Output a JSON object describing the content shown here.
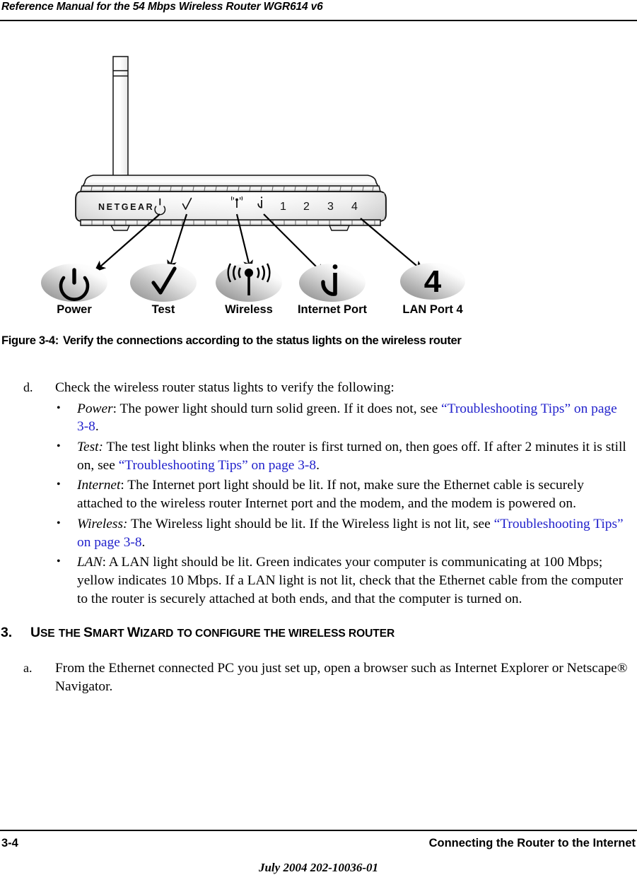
{
  "header": {
    "title": "Reference Manual for the 54 Mbps Wireless Router WGR614 v6"
  },
  "figure": {
    "router": {
      "brand": "NETGEAR",
      "led_labels": [
        "1",
        "2",
        "3",
        "4"
      ],
      "icons": [
        "power-icon",
        "test-check-icon",
        "wireless-icon",
        "internet-port-icon"
      ]
    },
    "callouts": [
      {
        "icon": "power-icon",
        "label": "Power"
      },
      {
        "icon": "test-check-icon",
        "label": "Test"
      },
      {
        "icon": "wireless-icon",
        "label": "Wireless"
      },
      {
        "icon": "internet-port-icon",
        "label": "Internet Port"
      },
      {
        "icon": "lan-port-4-icon",
        "label": "LAN Port 4",
        "glyph": "4"
      }
    ],
    "caption_number": "Figure 3-4:",
    "caption_text": "Verify the connections according to the status lights on the wireless router"
  },
  "content": {
    "step_d": {
      "marker": "d.",
      "text": "Check the wireless router status lights to verify the following:"
    },
    "bullets": [
      {
        "dot": "•",
        "term": "Power",
        "term_sep": ": ",
        "text_1": "The power light should turn solid green. If it does not, see ",
        "link": "“Troubleshooting Tips” on page 3-8",
        "text_2": "."
      },
      {
        "dot": "•",
        "term": "Test:",
        "term_sep": " ",
        "text_1": "The test light blinks when the router is first turned on, then goes off. If after 2 minutes it is still on, see ",
        "link": "“Troubleshooting Tips” on page 3-8",
        "text_2": "."
      },
      {
        "dot": "•",
        "term": "Internet",
        "term_sep": ": ",
        "text_1": "The Internet port light should be lit. If not, make sure the Ethernet cable is securely attached to the wireless router Internet port and the modem, and the modem is powered on.",
        "link": "",
        "text_2": ""
      },
      {
        "dot": "•",
        "term": "Wireless:",
        "term_sep": " ",
        "text_1": "The Wireless light should be lit. If the Wireless light is not lit, see ",
        "link": "“Troubleshooting Tips” on page 3-8",
        "text_2": "."
      },
      {
        "dot": "•",
        "term": "LAN",
        "term_sep": ": ",
        "text_1": "A LAN light should be lit. Green indicates your computer is communicating at 100 Mbps; yellow indicates 10 Mbps. If a LAN light is not lit, check that the Ethernet cable from the computer to the router is securely attached at both ends, and that the computer is turned on.",
        "link": "",
        "text_2": ""
      }
    ],
    "section_heading": {
      "number": "3.",
      "parts": [
        {
          "big": "U",
          "sm": "SE"
        },
        {
          "big": " ",
          "sm": "THE "
        },
        {
          "big": "S",
          "sm": "MART "
        },
        {
          "big": "W",
          "sm": "IZARD"
        },
        {
          "big": " ",
          "sm": "TO CONFIGURE THE WIRELESS ROUTER"
        }
      ],
      "plain": "3. USE THE SMART WIZARD TO CONFIGURE THE WIRELESS ROUTER"
    },
    "step_a": {
      "marker": "a.",
      "text": "From the Ethernet connected PC you just set up, open a browser such as Internet Explorer or Netscape® Navigator."
    }
  },
  "footer": {
    "page_number": "3-4",
    "chapter_title": "Connecting the Router to the Internet",
    "document_id": "July 2004 202-10036-01"
  },
  "colors": {
    "link": "#2222cc",
    "text": "#000000",
    "rule": "#000000",
    "router_body_light": "#ffffff",
    "router_body_mid": "#d8d8d8",
    "router_body_dark": "#a8a8a8",
    "bubble_dark": "#9a9a9a",
    "bubble_light": "#fdfdfd"
  }
}
